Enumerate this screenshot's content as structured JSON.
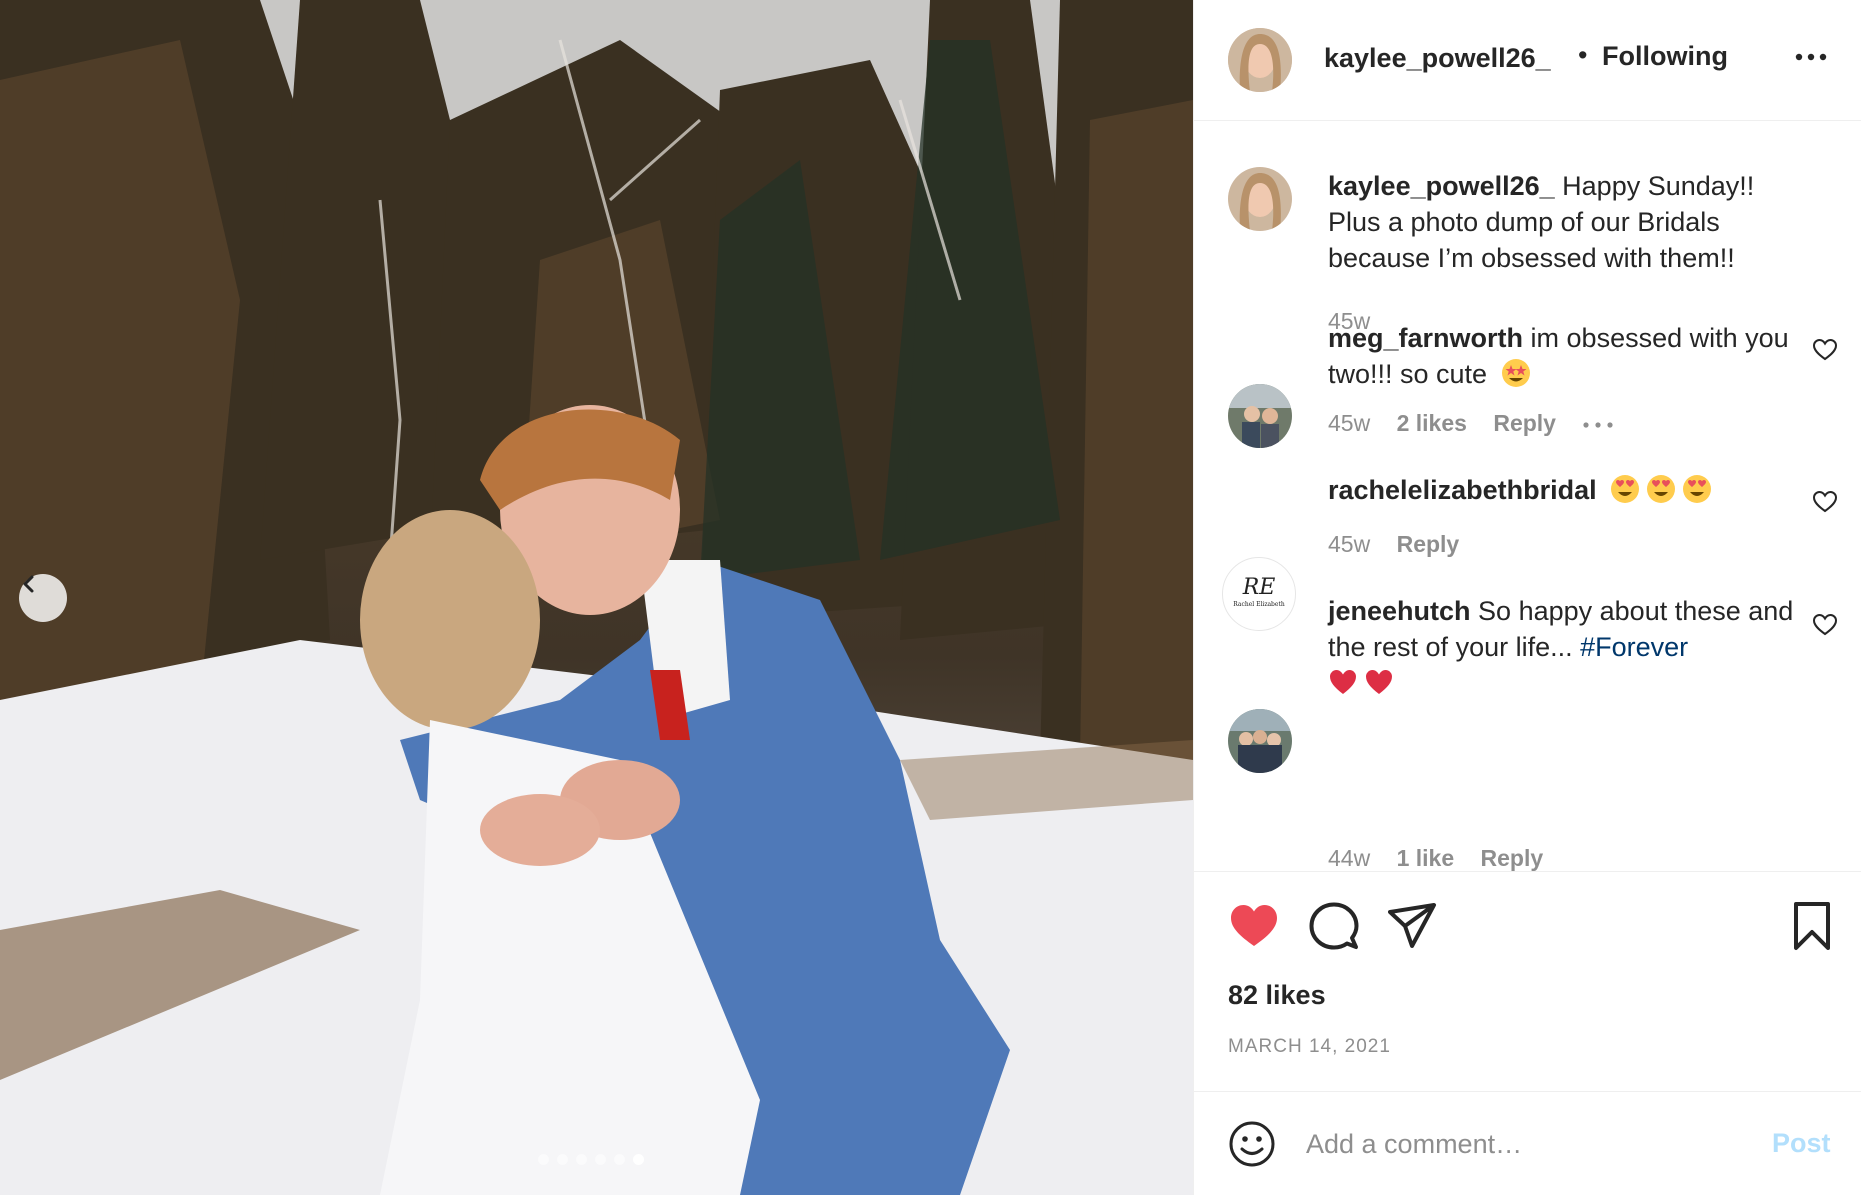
{
  "photo": {
    "carousel_count": 6,
    "active_index": 5
  },
  "header": {
    "username": "kaylee_powell26_",
    "separator": "•",
    "follow_status": "Following"
  },
  "caption": {
    "username": "kaylee_powell26_",
    "text": "Happy Sunday!! Plus a photo dump of our Bridals because I’m obsessed with them!!",
    "time": "45w"
  },
  "comments": [
    {
      "username": "meg_farnworth",
      "text": "im obsessed with you two!!! so cute",
      "emoji": [
        "star-struck-emoji"
      ],
      "time": "45w",
      "likes": "2 likes",
      "reply": "Reply"
    },
    {
      "username": "rachelelizabethbridal",
      "text": "",
      "emoji": [
        "heart-eyes-emoji",
        "heart-eyes-emoji",
        "heart-eyes-emoji"
      ],
      "time": "45w",
      "reply": "Reply",
      "avatar_monogram": "RE",
      "avatar_caption": "Rachel Elizabeth"
    },
    {
      "username": "jeneehutch",
      "text": "So happy about these and the rest of your life...",
      "hashtag": "#Forever",
      "emoji": [
        "red-heart-emoji",
        "red-heart-emoji"
      ],
      "time": "44w",
      "likes": "1 like",
      "reply": "Reply"
    }
  ],
  "actions": {
    "liked": true,
    "like_color": "#ed4956",
    "likes_text": "82 likes",
    "date": "MARCH 14, 2021"
  },
  "add_comment": {
    "placeholder": "Add a comment…",
    "post_label": "Post",
    "post_color": "#b2dffc"
  }
}
